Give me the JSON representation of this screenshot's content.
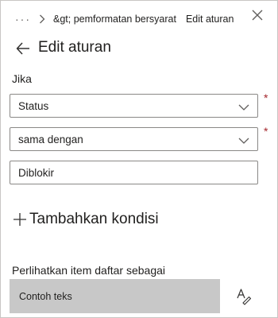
{
  "breadcrumb": {
    "more_label": "···",
    "crumb_1": "&gt; pemformatan bersyarat",
    "crumb_2": "Edit aturan"
  },
  "header": {
    "title": "Edit aturan"
  },
  "condition": {
    "if_label": "Jika",
    "column_select_value": "Status",
    "operator_select_value": "sama dengan",
    "value_input_value": "Diblokir",
    "required_marker": "*"
  },
  "add_condition": {
    "label": "Tambahkan kondisi"
  },
  "display": {
    "label": "Perlihatkan item daftar sebagai",
    "sample_text": "Contoh teks"
  },
  "icons": {
    "more": "more-icon",
    "chevron": "chevron-right-icon",
    "close": "close-icon",
    "back": "back-arrow-icon",
    "dropdown": "chevron-down-icon",
    "add": "plus-icon",
    "format": "text-format-icon"
  },
  "colors": {
    "required": "#a4262c",
    "sample_background": "#c8c8c8",
    "field_border": "#8a8886"
  }
}
